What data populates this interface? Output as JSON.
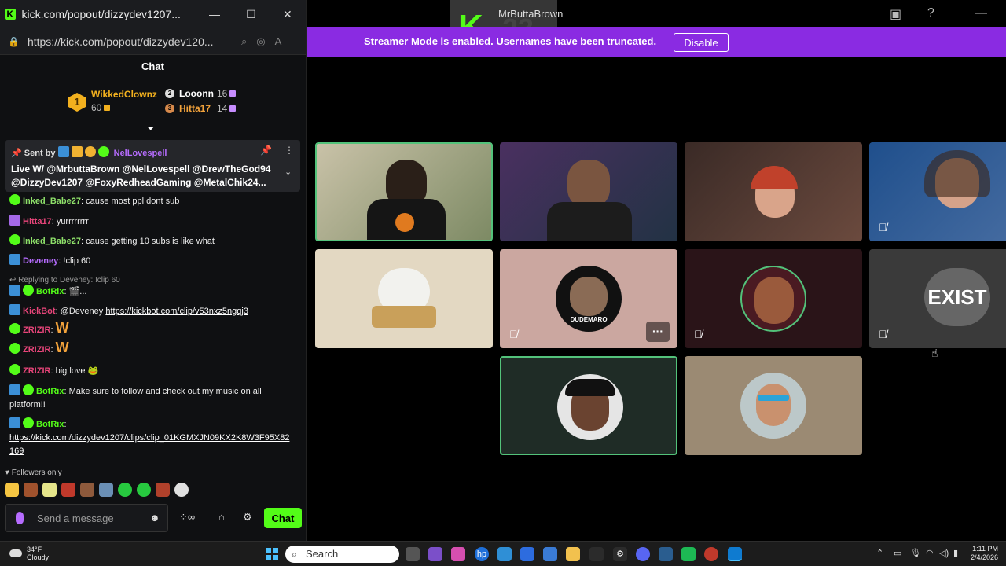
{
  "browser": {
    "title": "kick.com/popout/dizzydev1207...",
    "url": "https://kick.com/popout/dizzydev120..."
  },
  "chat": {
    "header": "Chat",
    "leaderboard": [
      {
        "rank": "1",
        "name": "WikkedClownz",
        "count": "60"
      },
      {
        "rank": "2",
        "name": "Looonn",
        "count": "16"
      },
      {
        "rank": "3",
        "name": "Hitta17",
        "count": "14"
      }
    ],
    "pinned": {
      "sent_by": "Sent by",
      "sender": "NelLovespell",
      "text": "Live W/ @MrbuttaBrown @NelLovespell @DrewTheGod94 @DizzyDev1207 @FoxyRedheadGaming @MetalChik24..."
    },
    "messages": [
      {
        "user": "Inked_Babe27",
        "color": "#8ee06a",
        "text": "cause most ppl dont sub"
      },
      {
        "user": "Hitta17",
        "color": "#e8457a",
        "text": "yurrrrrrrr"
      },
      {
        "user": "Inked_Babe27",
        "color": "#8ee06a",
        "text": "cause getting 10 subs is like what"
      },
      {
        "user": "Deveney",
        "color": "#b66cff",
        "text": "!clip 60"
      },
      {
        "reply": "Replying to Deveney: !clip 60"
      },
      {
        "user": "BotRix",
        "color": "#53fc18",
        "text": "🎬..."
      },
      {
        "user": "KickBot",
        "color": "#e8457a",
        "text": "@Deveney",
        "link": "https://kickbot.com/clip/v53nxz5ngqj3"
      },
      {
        "user": "ZRIZIR",
        "color": "#e8457a",
        "text": "W"
      },
      {
        "user": "ZRIZIR",
        "color": "#e8457a",
        "text": "W"
      },
      {
        "user": "ZRIZIR",
        "color": "#e8457a",
        "text": "big love"
      },
      {
        "user": "BotRix",
        "color": "#53fc18",
        "text": "Make sure to follow and check out my music on all platform!!"
      },
      {
        "user": "BotRix",
        "color": "#53fc18",
        "text": "",
        "link": "https://kick.com/dizzydev1207/clips/clip_01KGMXJN09KX2K8W3F95X82169"
      }
    ],
    "followers_only": "Followers only",
    "input_placeholder": "Send a message",
    "send_button": "Chat"
  },
  "call": {
    "host_name": "MrButtaBrown",
    "banner_text": "Streamer Mode is enabled. Usernames have been truncated.",
    "disable_button": "Disable",
    "tile_badge_text": "DUDEMARO",
    "tile_logo_text": "EXIST",
    "overlay_number": "23"
  },
  "taskbar": {
    "temp": "34°F",
    "weather": "Cloudy",
    "search": "Search",
    "time": "1:11 PM",
    "date": "2/4/2026"
  },
  "colors": {
    "kick_green": "#53fc18",
    "banner_purple": "#8a2be2",
    "active_border": "#53c27a"
  }
}
